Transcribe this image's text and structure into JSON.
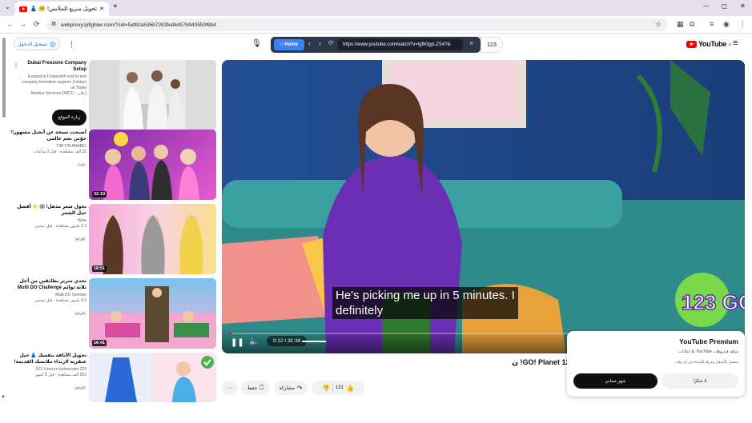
{
  "browser": {
    "tab_title": "تحويل سريع للملابس! 🤗 👗 🎀",
    "url": "webproxy.ipfighter.com/?sid=5af62a536b7263fed4457b940550f6b4",
    "nav": {
      "back": "←",
      "forward": "→",
      "reload": "⟳"
    },
    "window": {
      "minimize": "—",
      "maximize": "◻",
      "close": "✕"
    }
  },
  "proxy": {
    "home_label": "Home",
    "url": "https://www.youtube.com/watch?v=lgfk0gyLZS4?&",
    "count": "123",
    "back": "‹",
    "forward": "›",
    "reload": "⟳",
    "close": "×"
  },
  "header": {
    "signin": "تسجيل الدخول",
    "logo_text": "YouTube",
    "logo_sup": "AE"
  },
  "sidebar": {
    "ad": {
      "title": "Dubai Freezone Company Setup",
      "desc": "Expand to Dubai with end-to-end company formation support. Contact us Today",
      "source": "Nimbus Services DMCC · إعلان",
      "cta": "زيارة الموقع"
    },
    "items": [
      {
        "title": "أصبحت نسخة عن أنجيل مشهور!! حوّني نجم عالمي",
        "channel": "TIM TIN ARABIC",
        "views": "26 ألف مشاهدة · قبل 3 ساعات",
        "badge": "جديد",
        "duration": "32:10"
      },
      {
        "title": "تحول شعر مذهل! 😱 🌟 أفضل حيل الشعر",
        "channel": "Wow",
        "views": "3.2 مليون مشاهدة · قبل سنتين",
        "badge": "مُترجم",
        "duration": "18:51"
      },
      {
        "title": "تحدي سرير بطابقين من أجل ثلاثة توائم Multi DO Challenge",
        "channel": "Multi DO German",
        "views": "4.9 مليون مشاهدة · قبل سنتين",
        "badge": "مُترجم",
        "duration": "16:41"
      },
      {
        "title": "تحويل الأناقة بنفسك 👗 حيل عبقرية لارتداء ملابسك القديمة!",
        "channel": "123 GO! Unicorn Indonesian",
        "views": "552 ألف مشاهدة · قبل 5 أشهر",
        "badge": "مُترجم",
        "duration": ""
      }
    ]
  },
  "player": {
    "caption_line1": "He's picking me up in 5 minutes. I",
    "caption_line2": "definitely",
    "time": "0:12 / 31:38",
    "logo_text": "123 GO!",
    "progress": 0.0063
  },
  "video": {
    "title": "...GO! Planet 123! ن",
    "likes": "131",
    "share": "مشاركة",
    "save": "حفظ",
    "more": "⋯"
  },
  "premium": {
    "title": "YouTube Premium",
    "line1": "شاهد فيديوهات YouTube بلا إعلانات",
    "line2": "تشغيل بالأسعار وتنزيله للإنشاء في أي وقت",
    "trial": "شهر مجاني",
    "no_thanks": "لا شكرًا"
  },
  "colors": {
    "accent": "#065fd4",
    "yt_red": "#ff0000",
    "proxy_bar": "#2d3748",
    "home_button": "#3b82f6"
  }
}
